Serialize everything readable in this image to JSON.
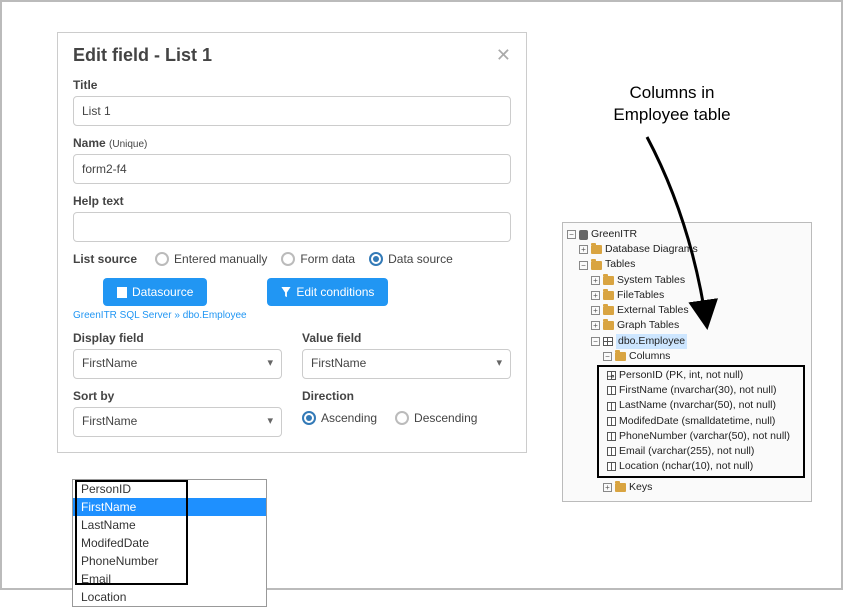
{
  "dialog": {
    "title": "Edit field - List 1",
    "close": "✕",
    "title_label": "Title",
    "title_value": "List 1",
    "name_label": "Name",
    "name_sub": "(Unique)",
    "name_value": "form2-f4",
    "help_label": "Help text",
    "help_value": "",
    "list_source_label": "List source",
    "radio_manual": "Entered manually",
    "radio_formdata": "Form data",
    "radio_datasource": "Data source",
    "btn_datasource": "Datasource",
    "btn_editcond": "Edit conditions",
    "breadcrumb_a": "GreenITR SQL Server",
    "breadcrumb_sep": "»",
    "breadcrumb_b": "dbo.Employee",
    "display_field_label": "Display field",
    "display_field_value": "FirstName",
    "value_field_label": "Value field",
    "value_field_value": "FirstName",
    "sort_by_label": "Sort by",
    "sort_by_value": "FirstName",
    "direction_label": "Direction",
    "direction_asc": "Ascending",
    "direction_desc": "Descending"
  },
  "dropdown": {
    "options": [
      "PersonID",
      "FirstName",
      "LastName",
      "ModifedDate",
      "PhoneNumber",
      "Email",
      "Location"
    ],
    "selected": "FirstName"
  },
  "annotation": {
    "line1": "Columns in",
    "line2": "Employee table"
  },
  "tree": {
    "root": "GreenITR",
    "db_diagrams": "Database Diagrams",
    "tables": "Tables",
    "system_tables": "System Tables",
    "file_tables": "FileTables",
    "external_tables": "External Tables",
    "graph_tables": "Graph Tables",
    "dbo_employee": "dbo.Employee",
    "columns": "Columns",
    "col_personid": "PersonID (PK, int, not null)",
    "col_firstname": "FirstName (nvarchar(30), not null)",
    "col_lastname": "LastName (nvarchar(50), not null)",
    "col_modifeddate": "ModifedDate (smalldatetime, null)",
    "col_phonenumber": "PhoneNumber (varchar(50), not null)",
    "col_email": "Email (varchar(255), not null)",
    "col_location": "Location (nchar(10), not null)",
    "keys": "Keys"
  }
}
